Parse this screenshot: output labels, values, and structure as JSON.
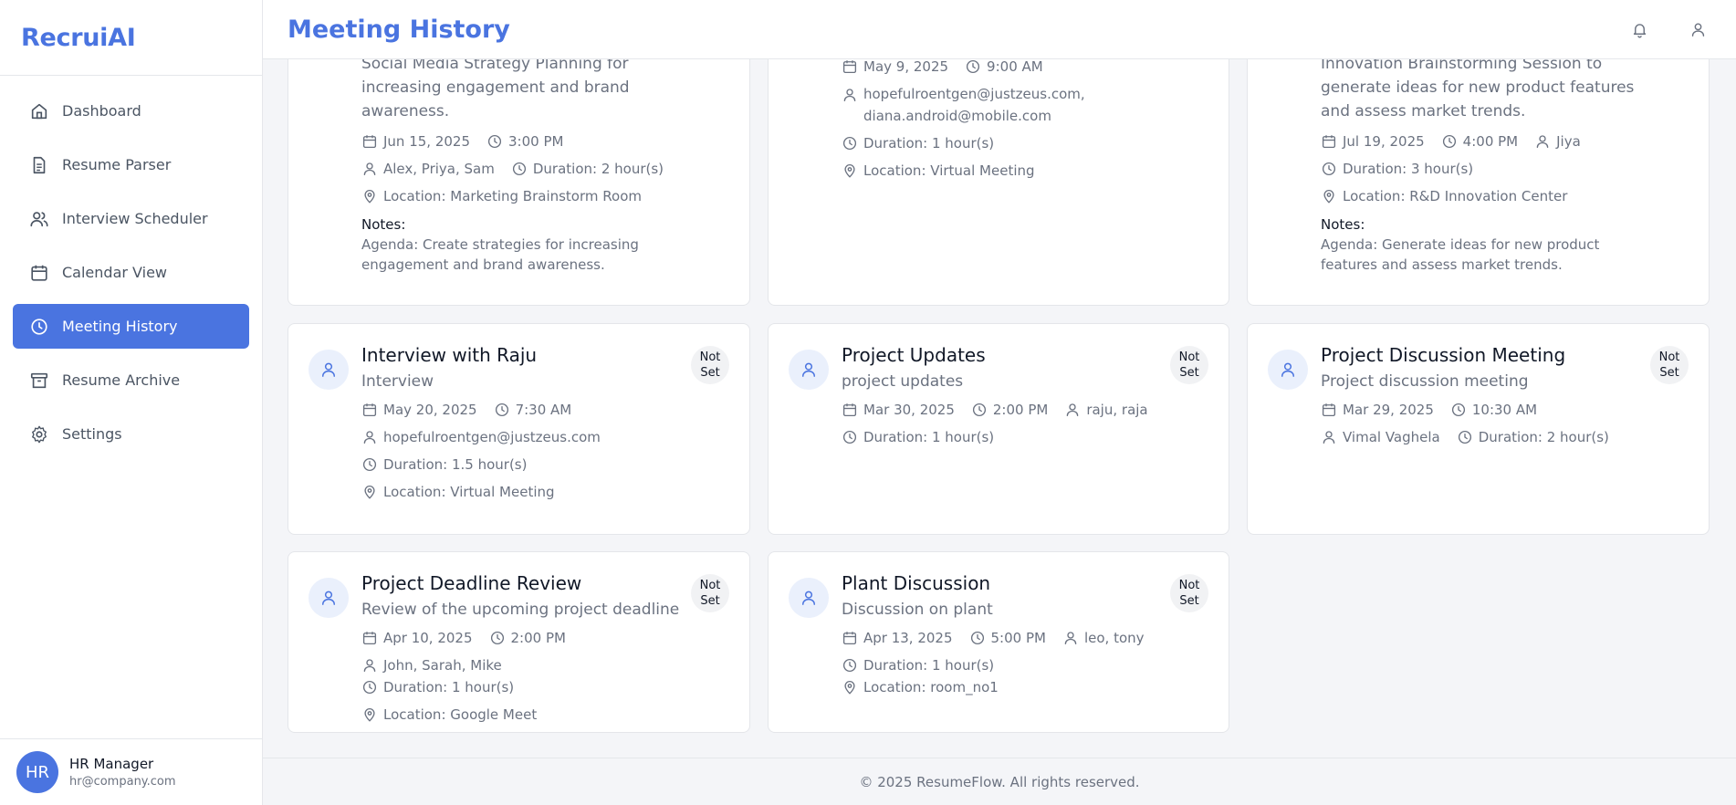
{
  "brand": "RecruiAI",
  "page_title": "Meeting History",
  "sidebar": {
    "items": [
      {
        "label": "Dashboard",
        "icon": "home-icon"
      },
      {
        "label": "Resume Parser",
        "icon": "document-icon"
      },
      {
        "label": "Interview Scheduler",
        "icon": "users-icon"
      },
      {
        "label": "Calendar View",
        "icon": "calendar-icon"
      },
      {
        "label": "Meeting History",
        "icon": "clock-icon",
        "active": true
      },
      {
        "label": "Resume Archive",
        "icon": "archive-icon"
      },
      {
        "label": "Settings",
        "icon": "gear-icon"
      }
    ],
    "user": {
      "initials": "HR",
      "name": "HR Manager",
      "email": "hr@company.com"
    }
  },
  "cards_top": [
    {
      "desc": "Social Media Strategy Planning for increasing engagement and brand awareness.",
      "date": "Jun 15, 2025",
      "time": "3:00 PM",
      "participants": "Alex, Priya, Sam",
      "duration": "Duration: 2 hour(s)",
      "location": "Location: Marketing Brainstorm Room",
      "notes_label": "Notes:",
      "notes": "Agenda: Create strategies for increasing engagement and brand awareness."
    },
    {
      "date": "May 9, 2025",
      "time": "9:00 AM",
      "participants": "hopefulroentgen@justzeus.com, diana.android@mobile.com",
      "duration": "Duration: 1 hour(s)",
      "location": "Location: Virtual Meeting"
    },
    {
      "desc": "Innovation Brainstorming Session to generate ideas for new product features and assess market trends.",
      "date": "Jul 19, 2025",
      "time": "4:00 PM",
      "participants": "Jiya",
      "duration": "Duration: 3 hour(s)",
      "location": "Location: R&D Innovation Center",
      "notes_label": "Notes:",
      "notes": "Agenda: Generate ideas for new product features and assess market trends."
    }
  ],
  "cards": [
    {
      "title": "Interview with Raju",
      "subtitle": "Interview",
      "badge": "Not Set",
      "date": "May 20, 2025",
      "time": "7:30 AM",
      "participants": "hopefulroentgen@justzeus.com",
      "duration": "Duration: 1.5 hour(s)",
      "location": "Location: Virtual Meeting"
    },
    {
      "title": "Project Updates",
      "subtitle": "project updates",
      "badge": "Not Set",
      "date": "Mar 30, 2025",
      "time": "2:00 PM",
      "participants": "raju, raja",
      "duration": "Duration: 1 hour(s)"
    },
    {
      "title": "Project Discussion Meeting",
      "subtitle": "Project discussion meeting",
      "badge": "Not Set",
      "date": "Mar 29, 2025",
      "time": "10:30 AM",
      "participants": "Vimal Vaghela",
      "duration": "Duration: 2 hour(s)"
    },
    {
      "title": "Project Deadline Review",
      "subtitle": "Review of the upcoming project deadline",
      "badge": "Not Set",
      "date": "Apr 10, 2025",
      "time": "2:00 PM",
      "participants": "John, Sarah, Mike",
      "duration": "Duration: 1 hour(s)",
      "location": "Location: Google Meet"
    },
    {
      "title": "Plant Discussion",
      "subtitle": "Discussion on plant",
      "badge": "Not Set",
      "date": "Apr 13, 2025",
      "time": "5:00 PM",
      "participants": "leo, tony",
      "duration": "Duration: 1 hour(s)",
      "location": "Location: room_no1"
    }
  ],
  "footer": "© 2025 ResumeFlow. All rights reserved.",
  "colors": {
    "accent": "#4a74e0",
    "avatar_bg": "#eaf0fc",
    "badge_bg": "#f1f2f4"
  }
}
